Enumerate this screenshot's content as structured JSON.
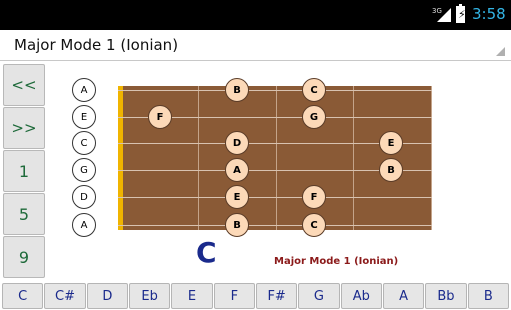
{
  "status": {
    "network": "3G",
    "time": "3:58"
  },
  "spinner": {
    "selected": "Major Mode 1 (Ionian)"
  },
  "side_buttons": {
    "prev": "<<",
    "next": ">>",
    "btn1": "1",
    "btn5": "5",
    "btn9": "9"
  },
  "open_strings": [
    "A",
    "E",
    "C",
    "G",
    "D",
    "A"
  ],
  "notes": [
    "B",
    "C",
    "F",
    "G",
    "D",
    "E",
    "A",
    "B",
    "E",
    "F",
    "B",
    "C"
  ],
  "key_display": "C",
  "mode_name": "Major Mode 1 (Ionian)",
  "keys": [
    "C",
    "C#",
    "D",
    "Eb",
    "E",
    "F",
    "F#",
    "G",
    "Ab",
    "A",
    "Bb",
    "B"
  ]
}
